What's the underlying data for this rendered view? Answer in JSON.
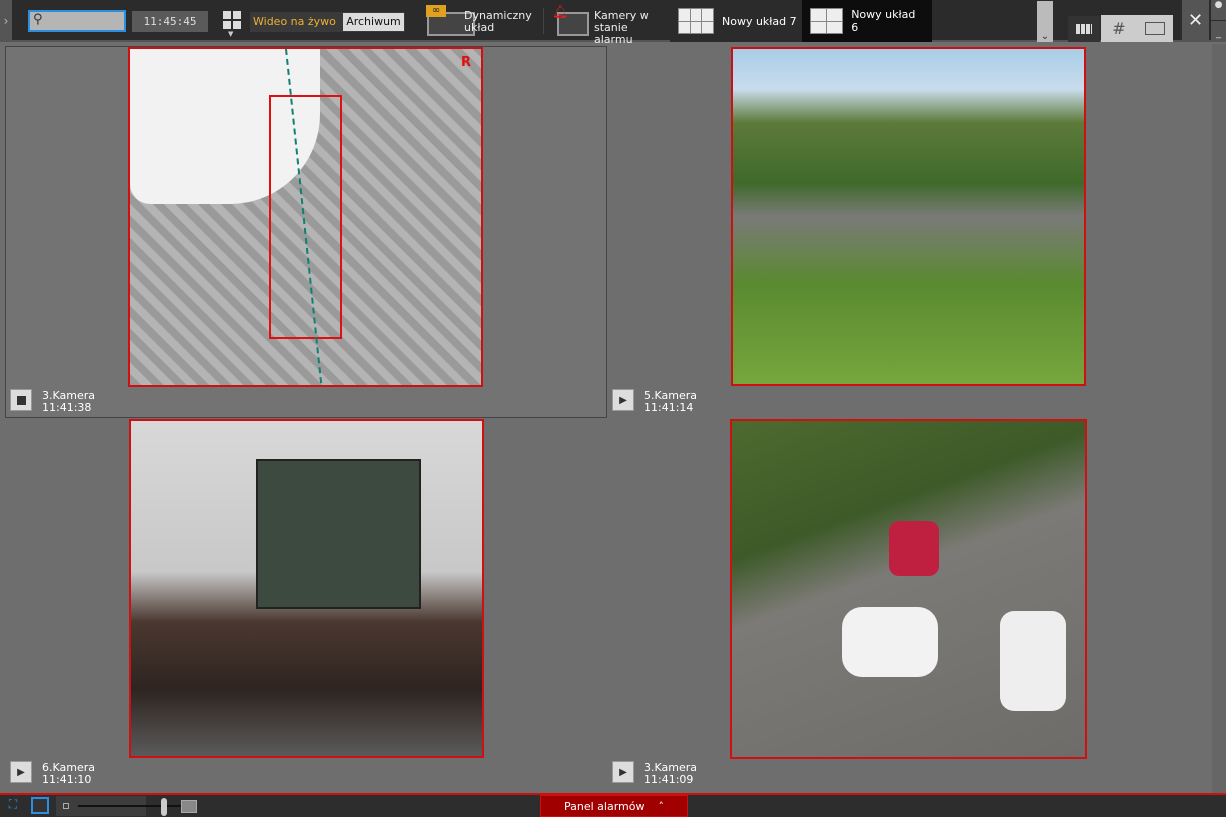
{
  "toolbar": {
    "search_placeholder": "",
    "clock": "11:45:45",
    "live_label": "Wideo na żywo",
    "archive_label": "Archiwum",
    "dynamic_layout": [
      "Dynamiczny",
      "układ"
    ],
    "alarm_cameras": [
      "Kamery w",
      "stanie alarmu"
    ],
    "layouts": [
      {
        "label": "Nowy układ 7"
      },
      {
        "label": "Nowy układ 6"
      }
    ]
  },
  "cameras": [
    {
      "name": "3.Kamera",
      "time": "11:41:38",
      "playing": true,
      "badge": "R"
    },
    {
      "name": "5.Kamera",
      "time": "11:41:14",
      "playing": false
    },
    {
      "name": "6.Kamera",
      "time": "11:41:10",
      "playing": false
    },
    {
      "name": "3.Kamera",
      "time": "11:41:09",
      "playing": false
    }
  ],
  "bottom": {
    "alarm_panel": "Panel alarmów"
  },
  "colors": {
    "accent": "#2a8fe0",
    "alarm": "#d01010",
    "live": "#f0b030"
  }
}
